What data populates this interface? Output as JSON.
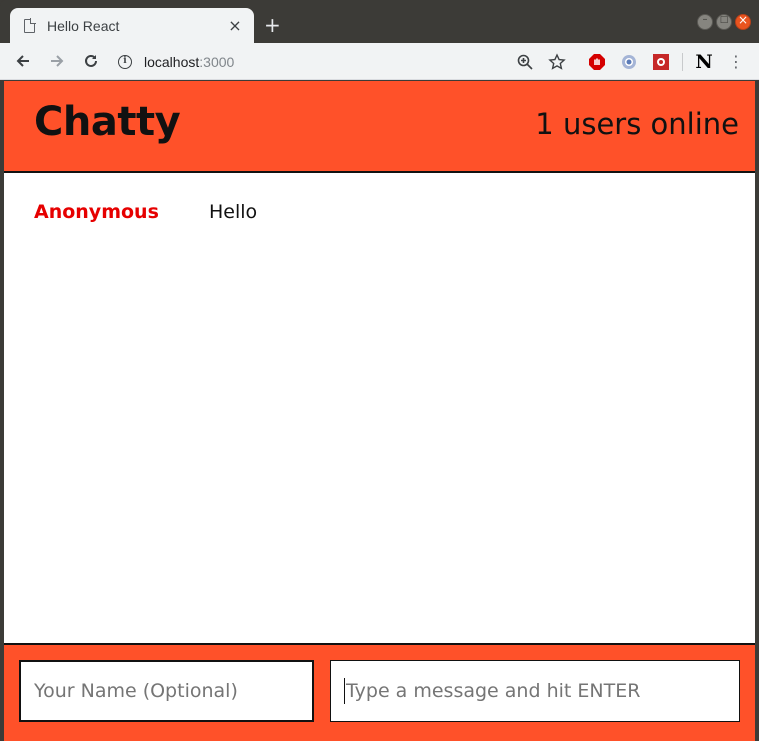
{
  "browser": {
    "tab_title": "Hello React",
    "tab_close": "×",
    "new_tab": "+",
    "url_host": "localhost",
    "url_port": ":3000",
    "info_glyph": "i",
    "extension_n": "N",
    "menu_glyph": "⋮"
  },
  "app": {
    "brand": "Chatty",
    "users_online": "1 users online",
    "accent_color": "#ff5129",
    "username_color": "#e60000"
  },
  "messages": [
    {
      "username": "Anonymous",
      "content": "Hello"
    }
  ],
  "chatbar": {
    "name_placeholder": "Your Name (Optional)",
    "message_placeholder": "Type a message and hit ENTER"
  }
}
